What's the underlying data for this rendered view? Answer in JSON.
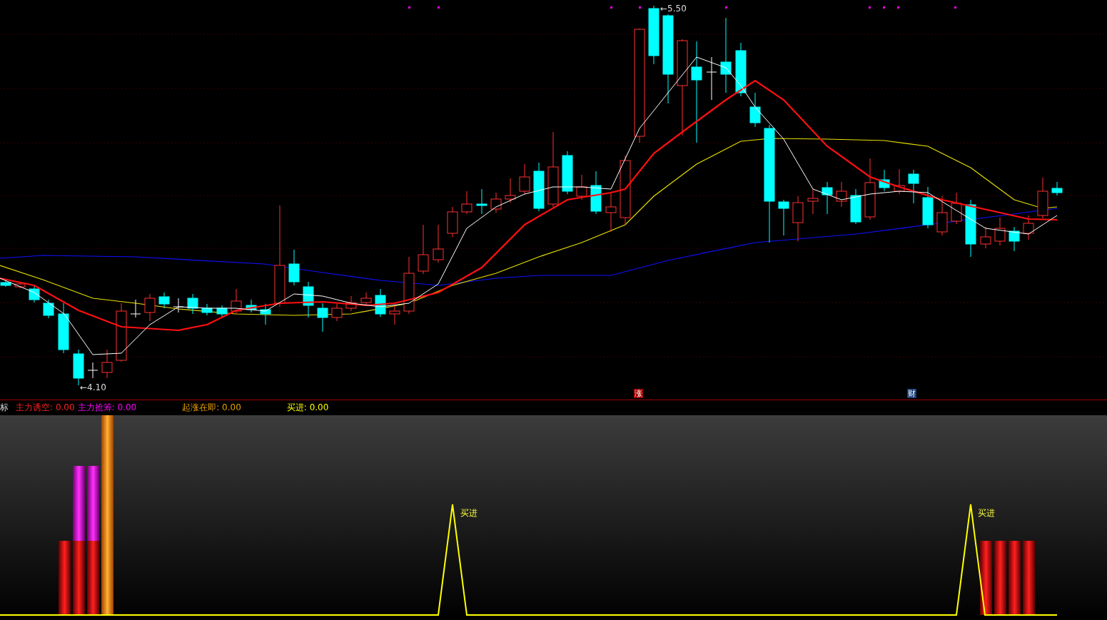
{
  "price_chart": {
    "high_label": {
      "arrow": "←",
      "value": "5.50"
    },
    "low_label": {
      "arrow": "←",
      "value": "4.10"
    },
    "markers": [
      {
        "text": "涨",
        "color": "#a00000"
      },
      {
        "text": "财",
        "color": "#1a3f7a"
      }
    ]
  },
  "indicator_legend": {
    "title_fragment": "标",
    "items": [
      {
        "label": "主力诱空:",
        "value": "0.00",
        "color": "#ff2020"
      },
      {
        "label": "主力抢筹:",
        "value": "0.00",
        "color": "#ff00ff"
      },
      {
        "label": "起涨在即:",
        "value": "0.00",
        "color": "#e8a000"
      },
      {
        "label": "买进:",
        "value": "0.00",
        "color": "#ffff00"
      }
    ]
  },
  "indicator_panel": {
    "signal_labels": [
      "买进",
      "买进"
    ]
  }
}
